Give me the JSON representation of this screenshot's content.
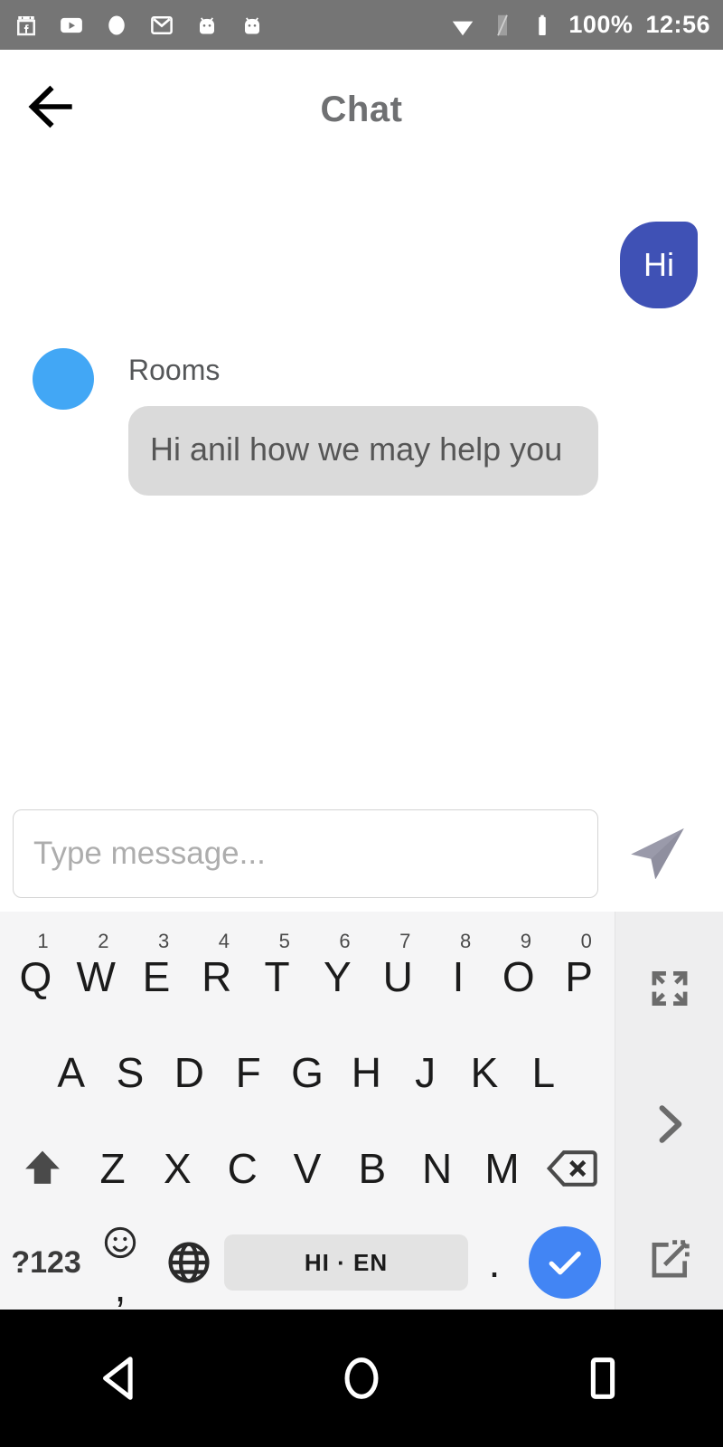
{
  "statusbar": {
    "left_icons": [
      "facebook-marketplace-icon",
      "youtube-icon",
      "circle-app-icon",
      "gmail-icon",
      "android-robot-icon",
      "android-robot-icon-2"
    ],
    "right_icons": [
      "wifi-icon",
      "sim-card-icon",
      "battery-icon"
    ],
    "battery_percent": "100%",
    "clock": "12:56",
    "bg_color": "#757575"
  },
  "header": {
    "back_icon": "arrow-left-icon",
    "title": "Chat",
    "title_color": "#6f7072"
  },
  "chat": {
    "outgoing": {
      "text": "Hi",
      "bubble_color": "#3f51b5",
      "text_color": "#ffffff"
    },
    "incoming": {
      "avatar_icon": "avatar-circle",
      "avatar_color": "#42a7f5",
      "sender": "Rooms",
      "text": "Hi anil how we may help you",
      "bubble_color": "#dadada",
      "text_color": "#565656"
    }
  },
  "composer": {
    "placeholder": "Type message...",
    "value": "",
    "send_icon": "send-paper-plane-icon",
    "send_icon_color": "#9a9aaa"
  },
  "keyboard": {
    "row1": [
      {
        "label": "Q",
        "sup": "1"
      },
      {
        "label": "W",
        "sup": "2"
      },
      {
        "label": "E",
        "sup": "3"
      },
      {
        "label": "R",
        "sup": "4"
      },
      {
        "label": "T",
        "sup": "5"
      },
      {
        "label": "Y",
        "sup": "6"
      },
      {
        "label": "U",
        "sup": "7"
      },
      {
        "label": "I",
        "sup": "8"
      },
      {
        "label": "O",
        "sup": "9"
      },
      {
        "label": "P",
        "sup": "0"
      }
    ],
    "row2": [
      "A",
      "S",
      "D",
      "F",
      "G",
      "H",
      "J",
      "K",
      "L"
    ],
    "row3_letters": [
      "Z",
      "X",
      "C",
      "V",
      "B",
      "N",
      "M"
    ],
    "shift_icon": "shift-arrow-up-icon",
    "backspace_icon": "backspace-delete-icon",
    "numbers_key": "?123",
    "comma_key": ",",
    "emoji_icon": "smiley-face-icon",
    "globe_icon": "globe-language-icon",
    "spacebar_label": "HI · EN",
    "period_key": ".",
    "enter_icon": "check-enter-icon",
    "enter_color": "#4285f4",
    "bg_color": "#f5f5f6",
    "sidebar": {
      "bg_color": "#eeeeef",
      "buttons": [
        "resize-fullscreen-icon",
        "chevron-right-icon",
        "floating-popout-icon"
      ]
    }
  },
  "navbar": {
    "back_icon": "nav-back-triangle-icon",
    "home_icon": "nav-home-circle-icon",
    "recents_icon": "nav-recents-square-icon",
    "bg_color": "#000000"
  }
}
